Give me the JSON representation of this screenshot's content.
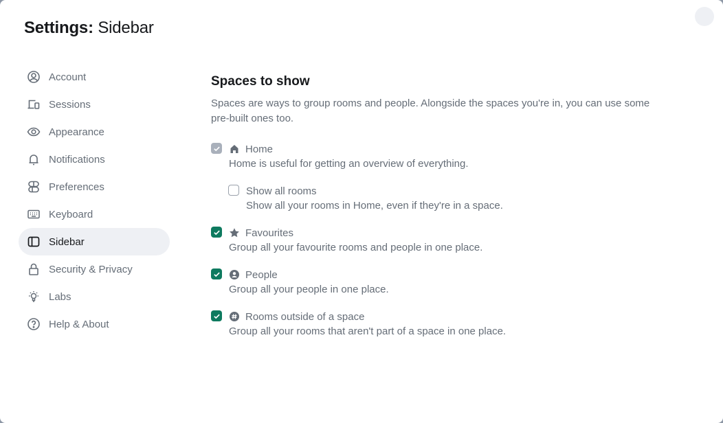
{
  "dialog": {
    "title_prefix": "Settings:",
    "title_page": "Sidebar",
    "close_label": ""
  },
  "nav": {
    "items": [
      {
        "label": "Account",
        "icon": "user-circle-icon",
        "active": false
      },
      {
        "label": "Sessions",
        "icon": "devices-icon",
        "active": false
      },
      {
        "label": "Appearance",
        "icon": "eye-icon",
        "active": false
      },
      {
        "label": "Notifications",
        "icon": "bell-icon",
        "active": false
      },
      {
        "label": "Preferences",
        "icon": "toggles-icon",
        "active": false
      },
      {
        "label": "Keyboard",
        "icon": "keyboard-icon",
        "active": false
      },
      {
        "label": "Sidebar",
        "icon": "sidebar-icon",
        "active": true
      },
      {
        "label": "Security & Privacy",
        "icon": "lock-icon",
        "active": false
      },
      {
        "label": "Labs",
        "icon": "lightbulb-icon",
        "active": false
      },
      {
        "label": "Help & About",
        "icon": "help-circle-icon",
        "active": false
      }
    ]
  },
  "content": {
    "section_title": "Spaces to show",
    "section_desc": "Spaces are ways to group rooms and people. Alongside the spaces you're in, you can use some pre-built ones too.",
    "options": [
      {
        "label": "Home",
        "icon": "home-icon",
        "desc": "Home is useful for getting an overview of everything.",
        "state": "checked-disabled"
      },
      {
        "label": "Show all rooms",
        "icon": "",
        "desc": "Show all your rooms in Home, even if they're in a space.",
        "state": "unchecked"
      },
      {
        "label": "Favourites",
        "icon": "star-icon",
        "desc": "Group all your favourite rooms and people in one place.",
        "state": "checked"
      },
      {
        "label": "People",
        "icon": "person-icon",
        "desc": "Group all your people in one place.",
        "state": "checked"
      },
      {
        "label": "Rooms outside of a space",
        "icon": "hash-icon",
        "desc": "Group all your rooms that aren't part of a space in one place.",
        "state": "checked"
      }
    ]
  },
  "colors": {
    "accent": "#0e7a5f",
    "active_bg": "#eef0f4",
    "text_primary": "#17191c",
    "text_secondary": "#656d77"
  }
}
